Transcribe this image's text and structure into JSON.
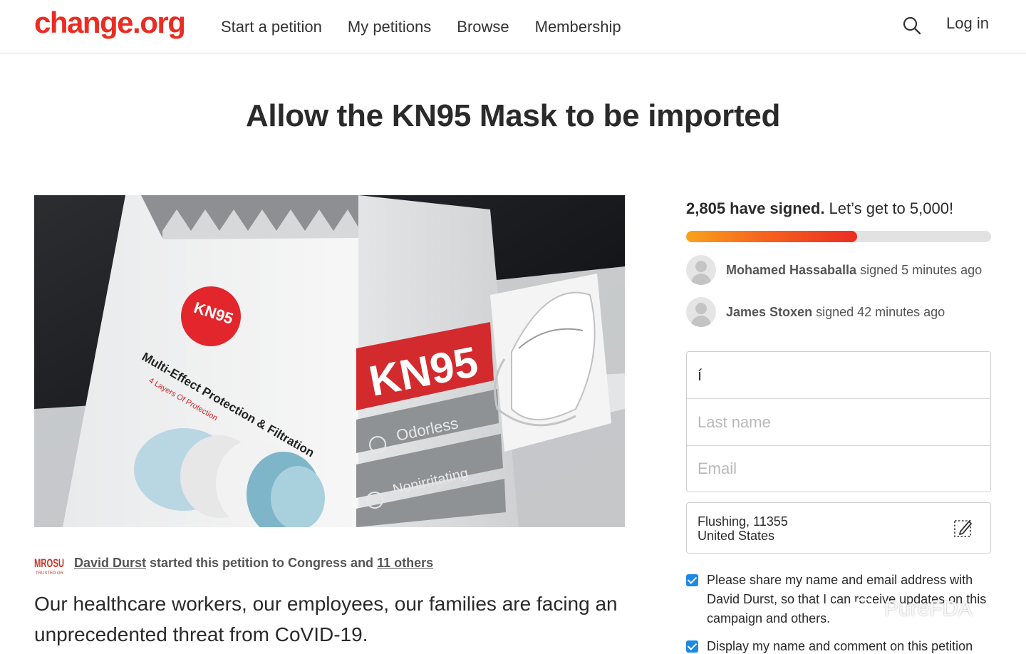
{
  "header": {
    "logo": "change.org",
    "nav": [
      "Start a petition",
      "My petitions",
      "Browse",
      "Membership"
    ],
    "login": "Log in"
  },
  "petition": {
    "title": "Allow the KN95 Mask to be imported",
    "photo_text": {
      "badge": "KN95",
      "tagline": "Multi-Effect Protection & Filtration",
      "layers": "4 Layers Of Protection",
      "banner": "KN95",
      "feature_1": "Odorless",
      "feature_2": "Nonirritating"
    },
    "org_logo_text": "MROSU",
    "org_logo_sub": "TRUSTED GR",
    "starter_name": "David Durst",
    "starter_middle": " started this petition to Congress and ",
    "starter_others": "11 others",
    "body": "Our healthcare workers, our employees, our families are facing an unprecedented threat from CoVID-19."
  },
  "signing": {
    "count_bold": "2,805 have signed.",
    "goal_text": " Let’s get to 5,000!",
    "progress": 0.561,
    "recent": [
      {
        "name": "Mohamed Hassaballa",
        "action": " signed 5 minutes ago"
      },
      {
        "name": "James Stoxen",
        "action": " signed 42 minutes ago"
      }
    ],
    "form": {
      "first_name_value": "í",
      "last_name_placeholder": "Last name",
      "email_placeholder": "Email"
    },
    "location": {
      "city": "Flushing, 11355",
      "country": "United States"
    },
    "checkboxes": [
      "Please share my name and email address with David Durst, so that I can receive updates on this campaign and others.",
      "Display my name and comment on this petition"
    ]
  },
  "watermark": "PureFDA",
  "colors": {
    "brand": "#ec2c22",
    "checkbox": "#1b8ae4",
    "progress_start": "#f9a21b",
    "progress_end": "#ec2c22"
  }
}
